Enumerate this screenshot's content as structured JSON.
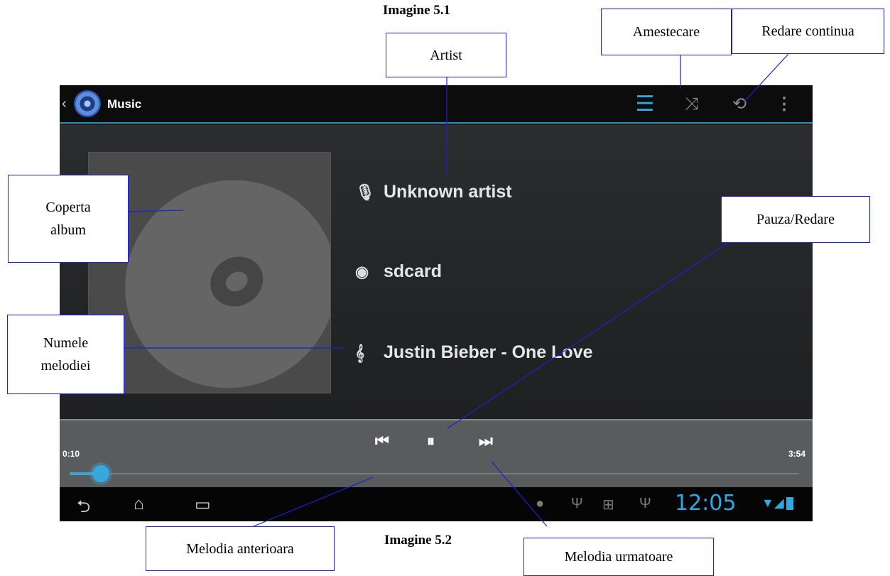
{
  "captions": {
    "top": "Imagine 5.1",
    "bottom": "Imagine 5.2"
  },
  "callouts": {
    "artist": "Artist",
    "shuffle": "Amestecare",
    "repeat": "Redare continua",
    "cover": "Coperta album",
    "pause_play": "Pauza/Redare",
    "song_name": "Numele melodiei",
    "prev": "Melodia anterioara",
    "next": "Melodia urmatoare"
  },
  "app": {
    "title": "Music",
    "icons": [
      "back-caret-icon",
      "music-app-icon",
      "playlist-icon",
      "shuffle-icon",
      "repeat-icon",
      "overflow-menu-icon"
    ]
  },
  "track": {
    "artist": "Unknown artist",
    "album": "sdcard",
    "song": "Justin Bieber - One Love"
  },
  "player": {
    "elapsed": "0:10",
    "duration": "3:54",
    "progress_fraction": 0.043,
    "accent_color": "#37a7dc"
  },
  "status_bar": {
    "clock": "12:05",
    "icons": [
      "back-icon",
      "home-icon",
      "recent-apps-icon",
      "usb-icon",
      "android-debug-icon",
      "usb-icon",
      "wifi-icon",
      "signal-icon",
      "battery-icon"
    ]
  },
  "callout_color": "#1f1fd6"
}
